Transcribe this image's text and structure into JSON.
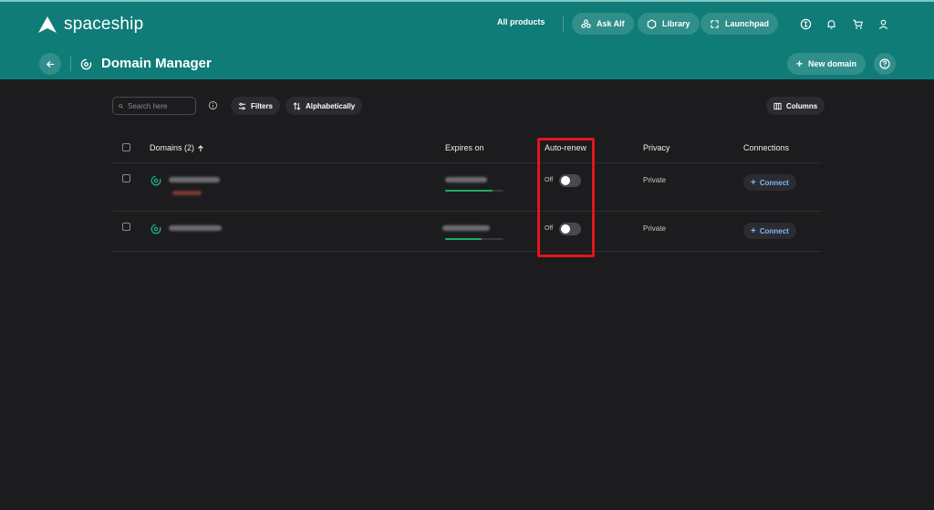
{
  "app": {
    "brand": "spaceship"
  },
  "topnav": {
    "all_products": "All products",
    "ask_alf": "Ask Alf",
    "library": "Library",
    "launchpad": "Launchpad"
  },
  "header": {
    "title": "Domain Manager",
    "new_domain": "New domain"
  },
  "toolbar": {
    "search_placeholder": "Search here",
    "filters": "Filters",
    "sort": "Alphabetically",
    "columns": "Columns"
  },
  "table": {
    "columns": {
      "domains": "Domains (2)",
      "expires": "Expires on",
      "auto_renew": "Auto-renew",
      "privacy": "Privacy",
      "connections": "Connections"
    },
    "rows": [
      {
        "auto_renew_label": "Off",
        "auto_renew_enabled": false,
        "privacy": "Private",
        "connect_label": "Connect",
        "expiry_progress": 0.82
      },
      {
        "auto_renew_label": "Off",
        "auto_renew_enabled": false,
        "privacy": "Private",
        "connect_label": "Connect",
        "expiry_progress": 0.62
      }
    ]
  },
  "colors": {
    "header_bg": "#0f7c78",
    "page_bg": "#1c1c1e",
    "highlight": "#e0161b",
    "progress": "#1faa62",
    "link": "#7ab8ff"
  }
}
